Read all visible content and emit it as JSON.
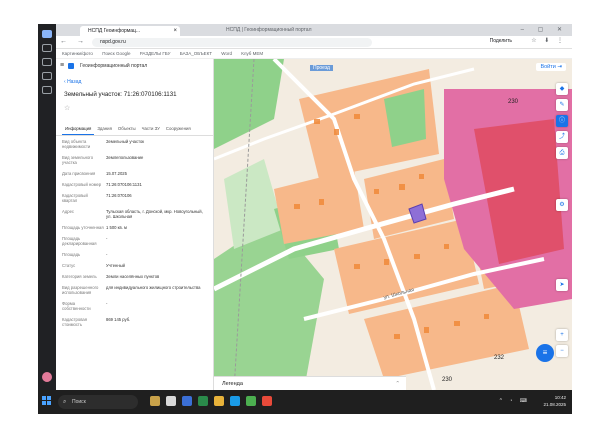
{
  "browser": {
    "tab_title": "НСПД Геоинформац...",
    "window_title": "НСПД | Геоинформационный портал",
    "url": "nspd.gov.ru",
    "share_label": "Поделить",
    "bookmarks": [
      "Картинки/фото",
      "Поиск Google",
      "РАЗДЕЛЫ ГБУ",
      "БАЗА_ОБЪЕКТ",
      "Word",
      "Клуб МЕМ"
    ]
  },
  "app": {
    "title": "Геоинформационный портал",
    "back_label": "Назад",
    "parcel_title": "Земельный участок: 71:26:070106:1131",
    "tabs": [
      "Информация",
      "Здания",
      "Объекты",
      "Части ЗУ",
      "Сооружения"
    ],
    "fields": [
      {
        "k": "Вид объекта недвижимости",
        "v": "Земельный участок"
      },
      {
        "k": "Вид земельного участка",
        "v": "Землепользование"
      },
      {
        "k": "Дата присвоения",
        "v": "15.07.2025"
      },
      {
        "k": "Кадастровый номер",
        "v": "71:26:070106:1131"
      },
      {
        "k": "Кадастровый квартал",
        "v": "71:26:070106"
      },
      {
        "k": "Адрес",
        "v": "Тульская область, г. Донской, мкр. Новоугольный, ул. Школьная"
      },
      {
        "k": "Площадь уточненная",
        "v": "1 500 кв. м"
      },
      {
        "k": "Площадь декларированная",
        "v": "-"
      },
      {
        "k": "Площадь",
        "v": "-"
      },
      {
        "k": "Статус",
        "v": "Учтенный"
      },
      {
        "k": "Категория земель",
        "v": "Земли населённых пунктов"
      },
      {
        "k": "Вид разрешенного использования",
        "v": "для индивидуального жилищного строительства"
      },
      {
        "k": "Форма собственности",
        "v": "-"
      },
      {
        "k": "Кадастровая стоимость",
        "v": "869 145 руб."
      }
    ]
  },
  "map": {
    "login_label": "Войти",
    "legend_label": "Легенда",
    "top_label": "Проезд",
    "numbers": [
      "230",
      "230",
      "232",
      "2"
    ],
    "street": "ул. Школьная"
  },
  "taskbar": {
    "search_placeholder": "Поиск",
    "time": "10:42",
    "date": "21.08.2025"
  }
}
